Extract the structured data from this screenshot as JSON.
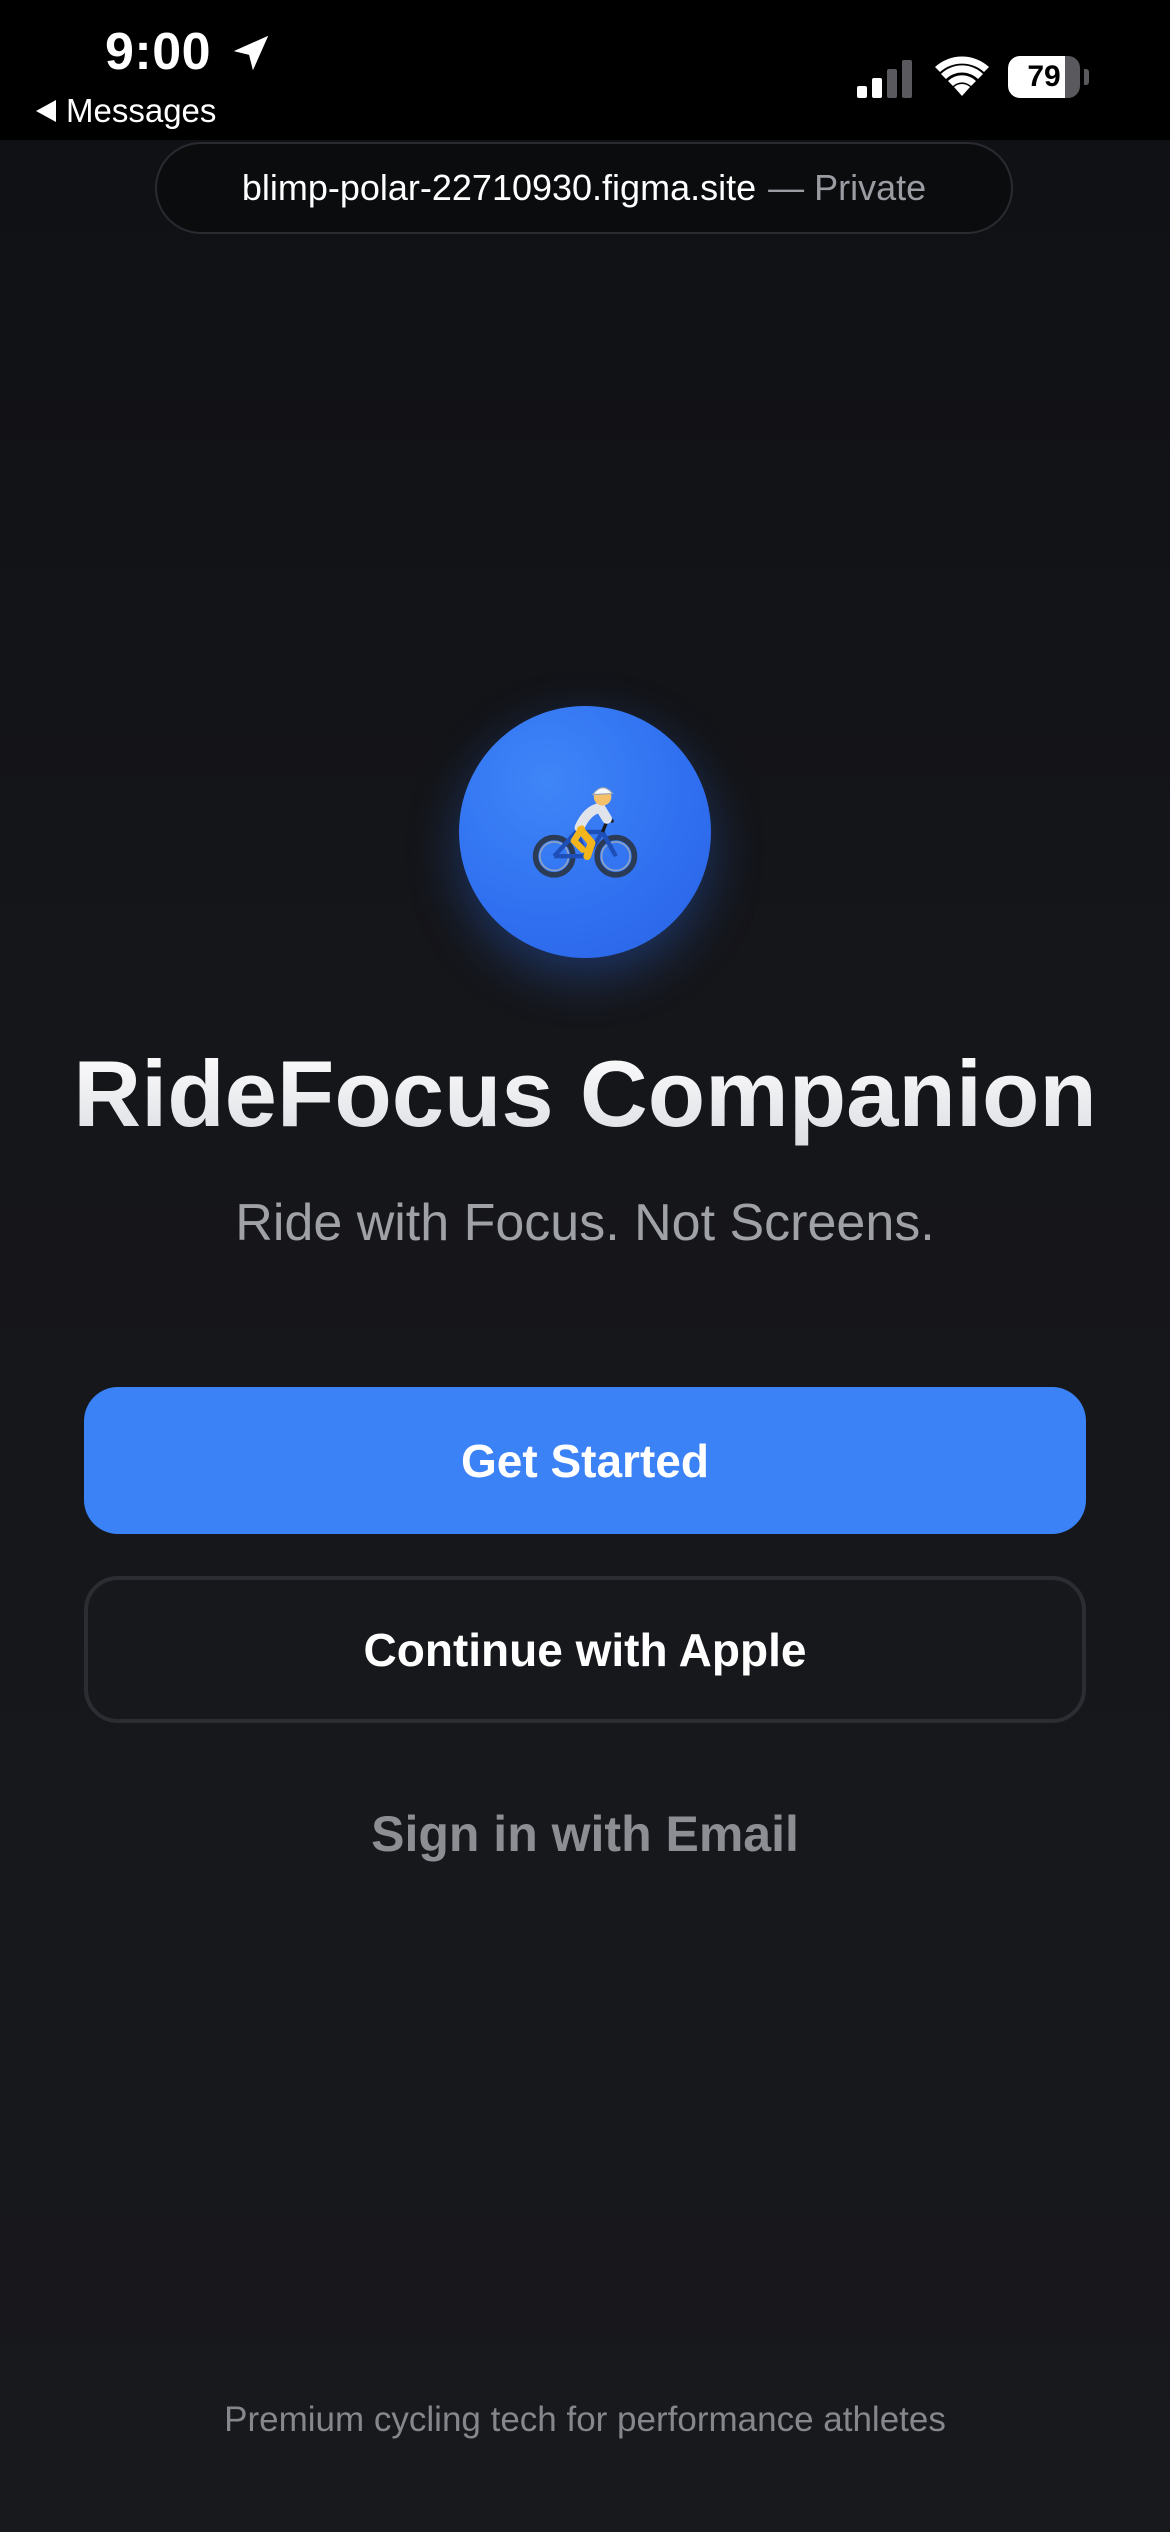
{
  "status_bar": {
    "time": "9:00",
    "back_label": "Messages",
    "battery_level": "79",
    "battery_fraction": 0.79,
    "icons": [
      "location-arrow-icon",
      "cellular-signal-icon",
      "wifi-icon",
      "battery-icon"
    ]
  },
  "browser": {
    "url": "blimp-polar-22710930.figma.site",
    "mode": "— Private"
  },
  "app": {
    "logo_icon": "cyclist-icon",
    "logo_color": "#2f6ff0",
    "title": "RideFocus Companion",
    "tagline": "Ride with Focus. Not Screens."
  },
  "actions": {
    "get_started": "Get Started",
    "continue_apple": "Continue with Apple",
    "sign_in_email": "Sign in with Email"
  },
  "footer": {
    "note": "Premium cycling tech for performance athletes"
  },
  "colors": {
    "accent": "#3b82f6",
    "background": "#15161a",
    "muted_text": "#a0a1a7"
  }
}
